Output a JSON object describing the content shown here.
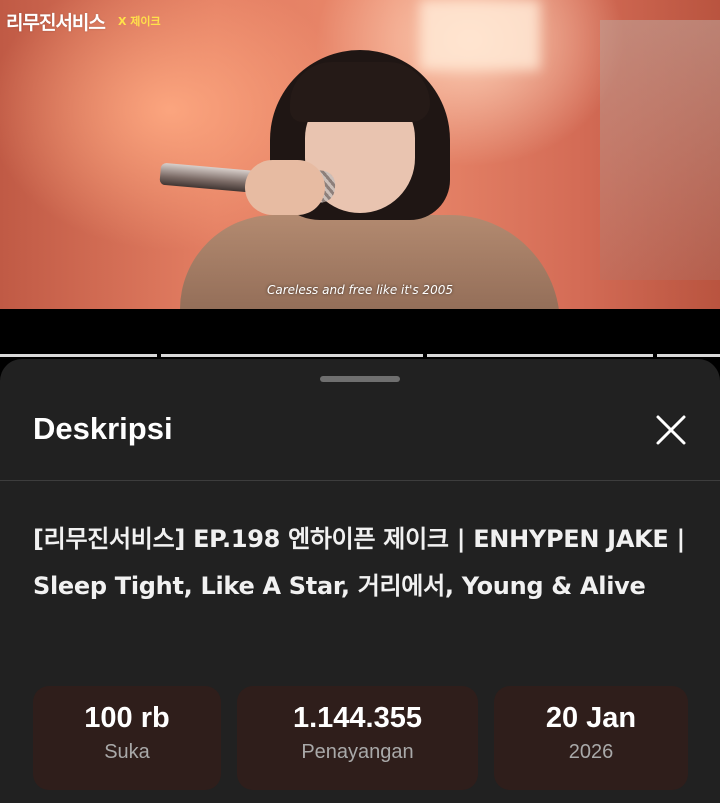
{
  "video": {
    "channel_logo": "리무진서비스",
    "logo_guest": "X 제이크",
    "caption": "Careless and free like it's 2005"
  },
  "sheet": {
    "title": "Deskripsi",
    "close_icon": "close-icon",
    "video_title": "[리무진서비스] EP.198 엔하이픈 제이크 | ENHYPEN JAKE | Sleep Tight, Like A Star, 거리에서, Young & Alive",
    "stats": [
      {
        "value": "100 rb",
        "label": "Suka"
      },
      {
        "value": "1.144.355",
        "label": "Penayangan"
      },
      {
        "value": "20 Jan",
        "label": "2026"
      }
    ]
  },
  "colors": {
    "sheet_bg": "#212121",
    "stat_bg": "#2f1e1b",
    "stat_label": "#a9a9a9"
  }
}
